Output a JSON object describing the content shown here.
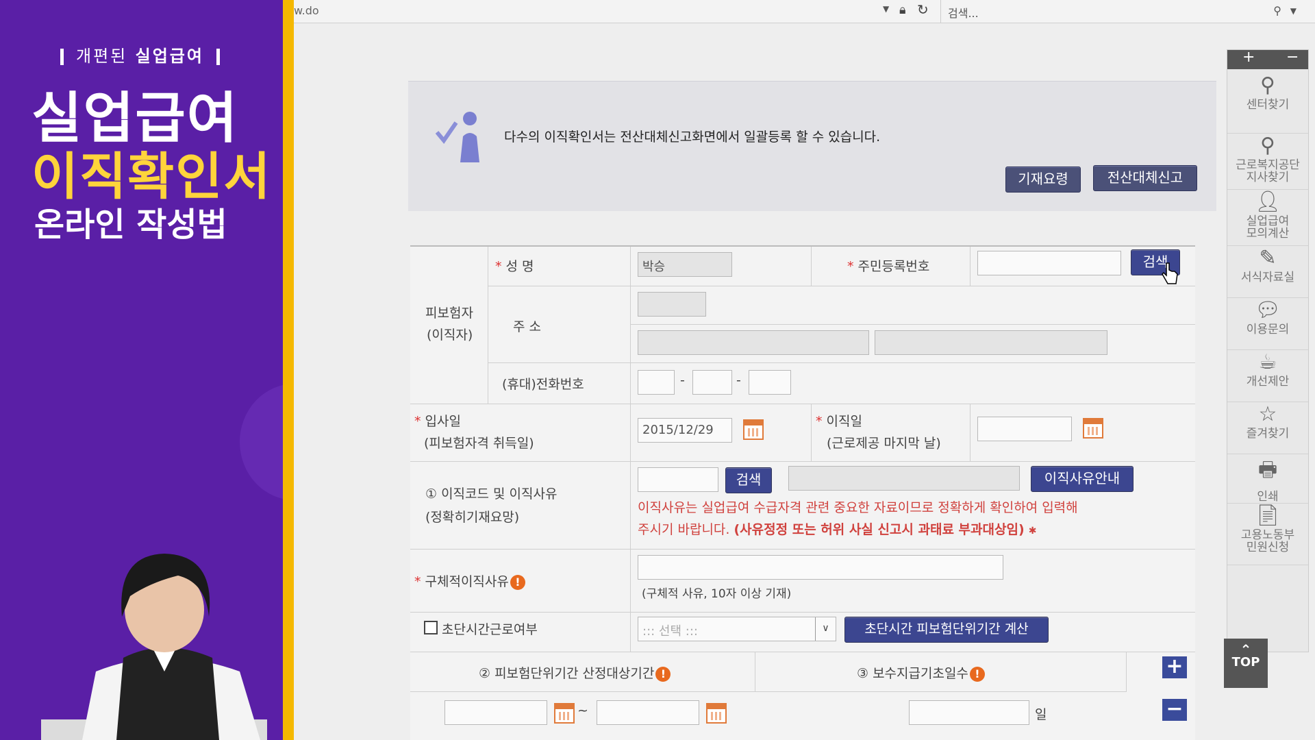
{
  "overlay": {
    "subtitle_pre": "개편된",
    "subtitle_bold": "실업급여",
    "title_line1": "실업급여",
    "title_line2": "이직확인서",
    "title_line3": "온라인 작성법"
  },
  "browser": {
    "url_fragment": "w.do",
    "search_placeholder": "검색..."
  },
  "notice": {
    "message": "다수의 이직확인서는 전산대체신고화면에서 일괄등록 할 수 있습니다.",
    "btn_guide": "기재요령",
    "btn_batch": "전산대체신고"
  },
  "form": {
    "group_insured": "피보험자",
    "group_insured_sub": "(이직자)",
    "name_label": "성 명",
    "name_value": "박승",
    "rrn_label": "주민등록번호",
    "rrn_search": "검색",
    "address_label": "주 소",
    "phone_label": "(휴대)전화번호",
    "phone_sep": "-",
    "hire_label": "입사일",
    "hire_sub": "(피보험자격 취득일)",
    "hire_value": "2015/12/29",
    "leave_label": "이직일",
    "leave_sub": "(근로제공 마지막 날)",
    "reason_label": "① 이직코드 및 이직사유",
    "reason_sub": "(정확히기재요망)",
    "reason_search": "검색",
    "reason_guide_btn": "이직사유안내",
    "reason_warning_1": "이직사유는 실업급여 수급자격 관련 중요한 자료이므로 정확하게 확인하여 입력해",
    "reason_warning_2": "주시기 바랍니다.",
    "reason_warning_bold": "(사유정정 또는 허위 사실 신고시 과태료 부과대상임)",
    "detail_label": "구체적이직사유",
    "detail_hint": "(구체적 사유, 10자 이상 기재)",
    "short_time_label": "초단시간근로여부",
    "short_time_select": "::: 선택 :::",
    "short_time_btn": "초단시간 피보험단위기간 계산",
    "period_label": "② 피보험단위기간 산정대상기간",
    "pay_days_label": "③ 보수지급기초일수",
    "tilde": "~",
    "day_unit": "일"
  },
  "quick_menu": {
    "items": [
      {
        "icon": "map-pin-icon",
        "label": "센터찾기"
      },
      {
        "icon": "map-pin-icon",
        "label": "근로복지공단\n지사찾기"
      },
      {
        "icon": "person-icon",
        "label": "실업급여\n모의계산"
      },
      {
        "icon": "edit-icon",
        "label": "서식자료실"
      },
      {
        "icon": "chat-icon",
        "label": "이용문의"
      },
      {
        "icon": "cup-icon",
        "label": "개선제안"
      },
      {
        "icon": "star-icon",
        "label": "즐겨찾기"
      },
      {
        "icon": "printer-icon",
        "label": "인쇄"
      },
      {
        "icon": "document-icon",
        "label": "고용노동부\n민원신청"
      }
    ],
    "top_label": "TOP"
  }
}
